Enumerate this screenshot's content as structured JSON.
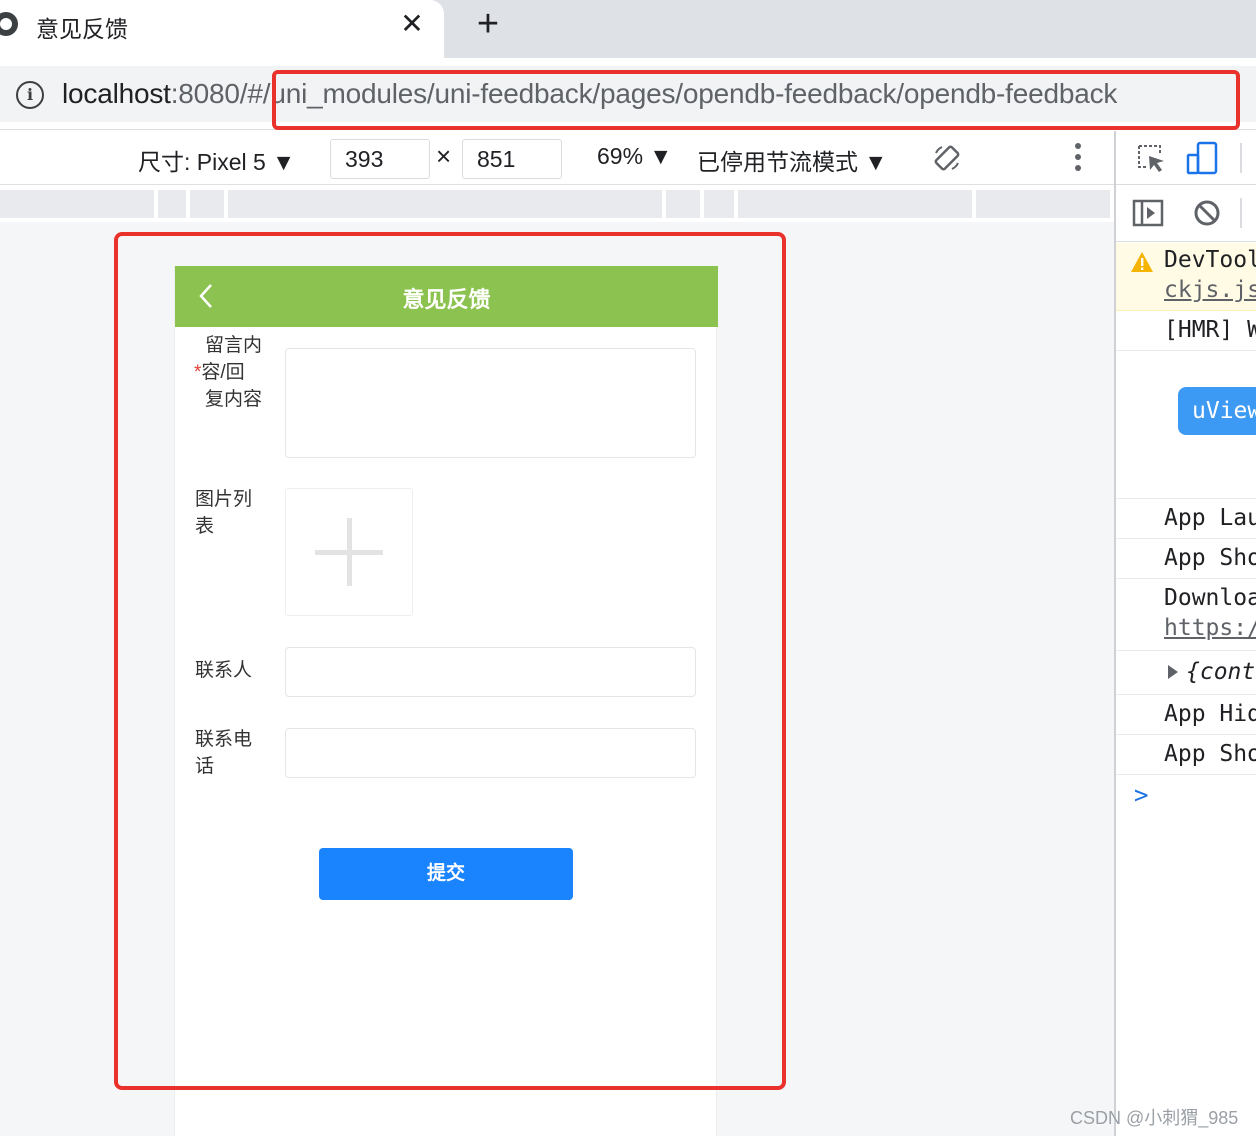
{
  "browser": {
    "tab_title": "意见反馈",
    "tab_close": "✕",
    "new_tab": "+",
    "url_host": "localhost",
    "url_rest": ":8080/#/uni_modules/uni-feedback/pages/opendb-feedback/opendb-feedback"
  },
  "device_toolbar": {
    "size_label": "尺寸: Pixel 5 ▼",
    "width": "393",
    "times": "×",
    "height": "851",
    "zoom": "69% ▼",
    "throttle": "已停用节流模式 ▼"
  },
  "app": {
    "header_title": "意见反馈",
    "header_color": "#8cc250",
    "form": {
      "content_label_line1": "留言内",
      "content_required": "*",
      "content_label_line2": "容/回",
      "content_label_line3": "复内容",
      "images_label_line1": "图片列",
      "images_label_line2": "表",
      "contact_label": "联系人",
      "phone_label_line1": "联系电",
      "phone_label_line2": "话"
    },
    "submit_label": "提交",
    "submit_color": "#1a84ff"
  },
  "devtools": {
    "warn_line1": "DevTool",
    "warn_line2": "ckjs.js",
    "hmr_line": "[HMR] W",
    "uview_badge": "uView",
    "log_1": "App Lau",
    "log_2": "App Sho",
    "log_3_line1": "Downloa",
    "log_3_line2": "https:/",
    "log_4": "{cont",
    "log_5": "App Hid",
    "log_6": "App Sho",
    "prompt": ">"
  },
  "watermark": "CSDN @小刺猬_985",
  "highlight_color": "#e8322b"
}
